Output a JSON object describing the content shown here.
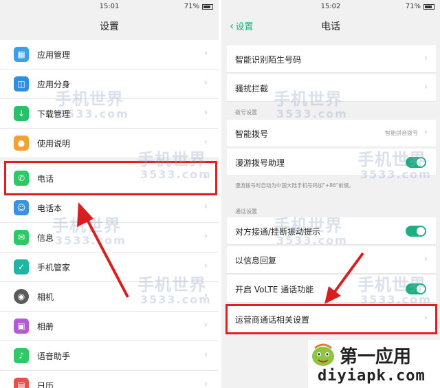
{
  "left": {
    "status_time": "15:01",
    "battery": "71%",
    "title": "设置",
    "items": [
      {
        "label": "应用管理",
        "icon": "apps-grid-icon",
        "color": "#3aa0e8"
      },
      {
        "label": "应用分身",
        "icon": "app-clone-icon",
        "color": "#2f8ee0"
      },
      {
        "label": "下载管理",
        "icon": "download-icon",
        "color": "#2bbf6c"
      },
      {
        "label": "使用说明",
        "icon": "lightbulb-icon",
        "color": "#f2a233"
      },
      {
        "label": "电话",
        "icon": "phone-icon",
        "color": "#2ec866"
      },
      {
        "label": "电话本",
        "icon": "contacts-icon",
        "color": "#3a8fe6"
      },
      {
        "label": "信息",
        "icon": "message-icon",
        "color": "#2ec866"
      },
      {
        "label": "手机管家",
        "icon": "shield-icon",
        "color": "#1fb5a0"
      },
      {
        "label": "相机",
        "icon": "camera-icon",
        "color": "#5a5a5a"
      },
      {
        "label": "相册",
        "icon": "gallery-icon",
        "color": "#b35ad6"
      },
      {
        "label": "语音助手",
        "icon": "microphone-icon",
        "color": "#2ec866"
      },
      {
        "label": "日历",
        "icon": "calendar-icon",
        "color": "#e85050"
      }
    ]
  },
  "right": {
    "status_time": "15:02",
    "battery": "71%",
    "back_label": "设置",
    "title": "电话",
    "rows_top": [
      {
        "label": "智能识别陌生号码"
      },
      {
        "label": "骚扰拦截"
      }
    ],
    "section_dial": "拨号设置",
    "smart_dial": {
      "label": "智能拨号",
      "value": "智能拼音拨号"
    },
    "roaming": {
      "label": "漫游拨号助理"
    },
    "roaming_note": "漫游拨号时自动为中国大陆手机号码加\"+86\"前缀。",
    "section_call": "通话设置",
    "rows_call": [
      {
        "label": "对方接通/挂断振动提示",
        "toggle": true
      },
      {
        "label": "以信息回复",
        "toggle": false
      },
      {
        "label": "开启 VoLTE 通话功能",
        "toggle": true
      },
      {
        "label": "运营商通话相关设置",
        "toggle": false
      }
    ]
  },
  "watermark": {
    "text": "手机世界",
    "sub": "3533.com"
  },
  "corner_logo": {
    "text": "第一应用",
    "domain": "diyiapk.com"
  },
  "colors": {
    "accent": "#1cb080",
    "highlight": "#e02020"
  }
}
